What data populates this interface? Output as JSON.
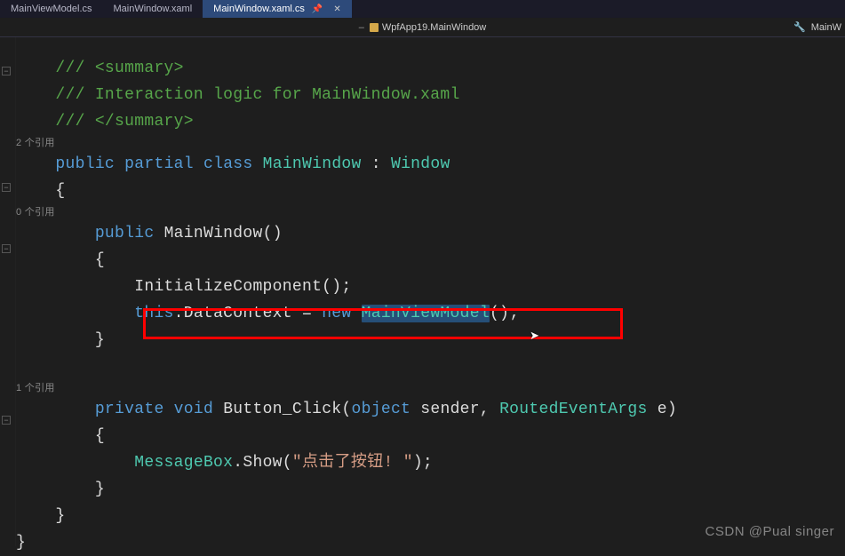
{
  "tabs": [
    {
      "label": "MainViewModel.cs",
      "active": false
    },
    {
      "label": "MainWindow.xaml",
      "active": false
    },
    {
      "label": "MainWindow.xaml.cs",
      "active": true
    }
  ],
  "breadcrumb": {
    "class": "WpfApp19.MainWindow",
    "right": "MainW"
  },
  "codelens": {
    "class_refs": "2 个引用",
    "ctor_refs": "0 个引用",
    "btn_refs": "1 个引用"
  },
  "code": {
    "summary_open": "/// <summary>",
    "summary_text": "/// Interaction logic for MainWindow.xaml",
    "summary_close": "/// </summary>",
    "kw_public": "public",
    "kw_partial": "partial",
    "kw_class": "class",
    "class_name": "MainWindow",
    "base_class": "Window",
    "ctor_name": "MainWindow",
    "init_call": "InitializeComponent();",
    "kw_this": "this",
    "datacontext": ".DataContext = ",
    "kw_new": "new",
    "viewmodel": "MainViewModel",
    "viewmodel_end": "();",
    "kw_private": "private",
    "kw_void": "void",
    "btn_method": "Button_Click",
    "kw_object": "object",
    "param_sender": " sender, ",
    "args_type": "RoutedEventArgs",
    "param_e": " e)",
    "msgbox_class": "MessageBox",
    "msgbox_method": ".Show(",
    "msgbox_str": "\"点击了按钮! \"",
    "msgbox_end": ");"
  },
  "watermark": "CSDN @Pual singer"
}
